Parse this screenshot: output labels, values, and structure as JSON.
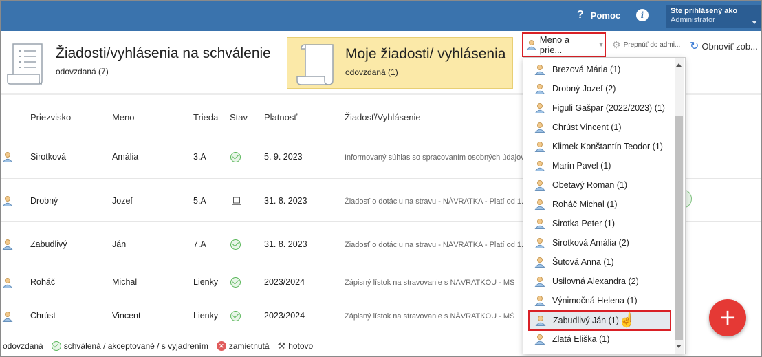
{
  "topbar": {
    "help_label": "Pomoc",
    "help_icon": "question-icon",
    "info_icon": "info-icon",
    "user_line1": "Ste prihlásený ako",
    "user_line2": "Administrátor"
  },
  "tiles": [
    {
      "title": "Žiadosti/vyhlásenia na schválenie",
      "subtitle": "odovzdaná (7)"
    },
    {
      "title": "Moje žiadosti/ vyhlásenia",
      "subtitle": "odovzdaná (1)"
    }
  ],
  "toolbar": {
    "filter_label": "Meno a prie...",
    "switch_label": "Prepnúť do admi...",
    "refresh_label": "Obnoviť zob..."
  },
  "table": {
    "headers": [
      "Priezvisko",
      "Meno",
      "Trieda",
      "Stav",
      "Platnosť",
      "Žiadosť/Vyhlásenie"
    ],
    "rows": [
      {
        "surname": "Sirotková",
        "name": "Amália",
        "class": "3.A",
        "status": "schválená",
        "validity": "5. 9. 2023",
        "request": "Informovaný súhlas so spracovaním osobných údajov"
      },
      {
        "surname": "Drobný",
        "name": "Jozef",
        "class": "5.A",
        "status": "odovzdaná",
        "validity": "31. 8. 2023",
        "request": "Žiadosť o dotáciu na stravu - NÁVRATKA - Platí od 1."
      },
      {
        "surname": "Zabudlivý",
        "name": "Ján",
        "class": "7.A",
        "status": "schválená",
        "validity": "31. 8. 2023",
        "request": "Žiadosť o dotáciu na stravu - NÁVRATKA - Platí od 1."
      },
      {
        "surname": "Roháč",
        "name": "Michal",
        "class": "Lienky",
        "status": "schválená",
        "validity": "2023/2024",
        "request": "Zápisný lístok na stravovanie s NÁVRATKOU - MŠ"
      },
      {
        "surname": "Chrúst",
        "name": "Vincent",
        "class": "Lienky",
        "status": "schválená",
        "validity": "2023/2024",
        "request": "Zápisný lístok na stravovanie s NÁVRATKOU - MŠ"
      }
    ]
  },
  "legend": {
    "submitted": "odovzdaná",
    "approved": "schválená / akceptované / s vyjadrením",
    "rejected": "zamietnutá",
    "done": "hotovo"
  },
  "fab_label": "+",
  "dropdown": {
    "items": [
      "Brezová Mária (1)",
      "Drobný Jozef (2)",
      "Figuli Gašpar (2022/2023) (1)",
      "Chrúst Vincent (1)",
      "Klimek Konštantín Teodor (1)",
      "Marín Pavel (1)",
      "Obetavý Roman (1)",
      "Roháč Michal (1)",
      "Sirotka Peter (1)",
      "Sirotková Amália (2)",
      "Šutová Anna (1)",
      "Usilovná Alexandra (2)",
      "Výnimočná Helena (1)",
      "Zabudlivý Ján (1)",
      "Zlatá Eliška (1)"
    ],
    "selected_index": 13
  }
}
